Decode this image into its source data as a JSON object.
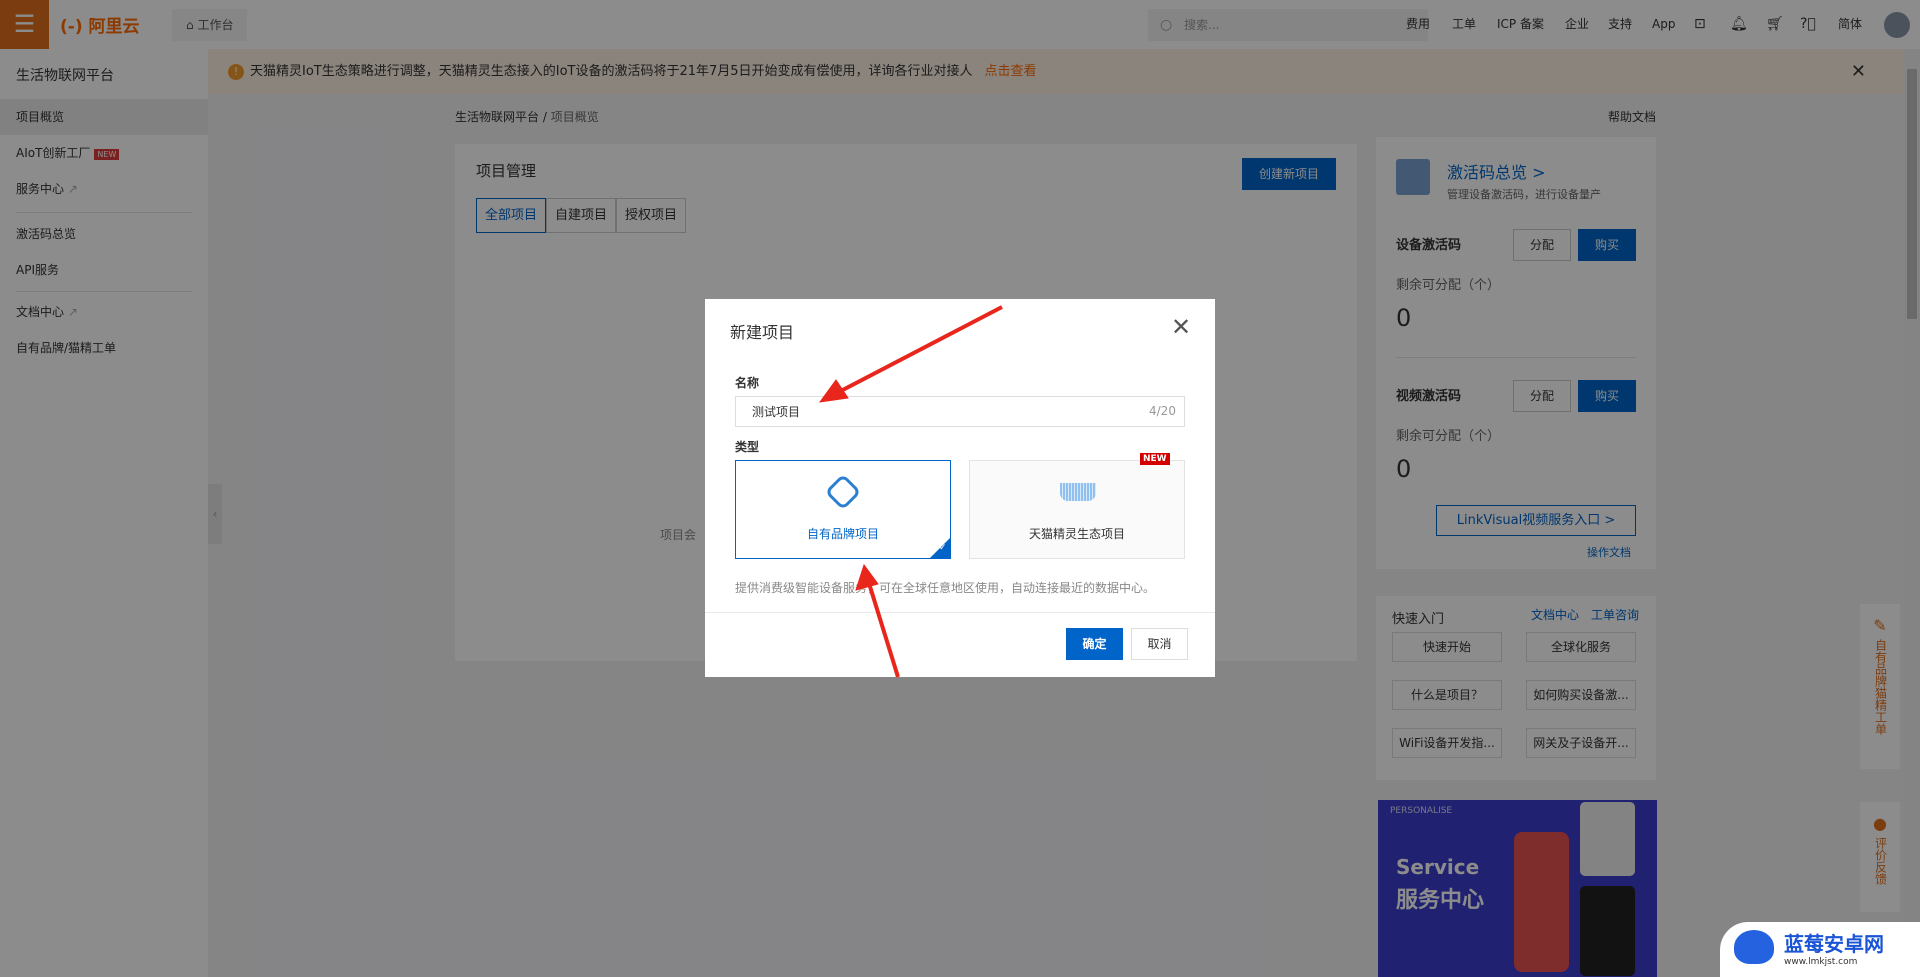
{
  "topbar": {
    "logo": "(-) 阿里云",
    "workbench": "工作台",
    "search_placeholder": "搜索...",
    "nav": [
      "费用",
      "工单",
      "ICP 备案",
      "企业",
      "支持",
      "App"
    ],
    "lang": "简体"
  },
  "sidebar": {
    "title": "生活物联网平台",
    "items": [
      {
        "label": "项目概览",
        "active": true
      },
      {
        "label": "AIoT创新工厂",
        "badge": "NEW"
      },
      {
        "label": "服务中心",
        "external": true
      },
      {
        "label": "激活码总览"
      },
      {
        "label": "API服务"
      },
      {
        "label": "文档中心",
        "external": true
      },
      {
        "label": "自有品牌/猫精工单"
      }
    ]
  },
  "notice": {
    "text": "天猫精灵IoT生态策略进行调整，天猫精灵生态接入的IoT设备的激活码将于21年7月5日开始变成有偿使用，详询各行业对接人",
    "link": "点击查看"
  },
  "breadcrumb": [
    "生活物联网平台",
    "项目概览"
  ],
  "help_doc": "帮助文档",
  "project": {
    "title": "项目管理",
    "create_button": "创建新项目",
    "tabs": [
      "全部项目",
      "自建项目",
      "授权项目"
    ],
    "active_tab": "全部项目",
    "empty_text": "项目会"
  },
  "activation": {
    "title": "激活码总览 >",
    "subtitle": "管理设备激活码，进行设备量产",
    "device": {
      "label": "设备激活码",
      "assign": "分配",
      "buy": "购买",
      "remain_label": "剩余可分配（个）",
      "remain": "0"
    },
    "video": {
      "label": "视频激活码",
      "assign": "分配",
      "buy": "购买",
      "remain_label": "剩余可分配（个）",
      "remain": "0"
    },
    "linkvisual": "LinkVisual视频服务入口  >",
    "op_doc": "操作文档"
  },
  "quick": {
    "title": "快速入门",
    "links": [
      "文档中心",
      "工单咨询"
    ],
    "buttons": [
      "快速开始",
      "全球化服务",
      "什么是项目？",
      "如何购买设备激...",
      "WiFi设备开发指...",
      "网关及子设备开..."
    ]
  },
  "promo": {
    "tag": "PERSONALISE",
    "title_en": "Service",
    "title_cn": "服务中心"
  },
  "float": {
    "ticket": "自有品牌猫精工单",
    "feedback": "评价反馈"
  },
  "dialog": {
    "title": "新建项目",
    "name_label": "名称",
    "name_value": "测试项目",
    "counter": "4/20",
    "type_label": "类型",
    "types": [
      {
        "label": "自有品牌项目",
        "selected": true
      },
      {
        "label": "天猫精灵生态项目",
        "badge": "NEW"
      }
    ],
    "description": "提供消费级智能设备服务，可在全球任意地区使用，自动连接最近的数据中心。",
    "ok": "确定",
    "cancel": "取消"
  },
  "watermark": {
    "name": "蓝莓安卓网",
    "url": "www.lmkjst.com"
  },
  "colors": {
    "brand": "#ff6a00",
    "primary": "#0064c8",
    "annotation_arrow": "#e8261c"
  }
}
